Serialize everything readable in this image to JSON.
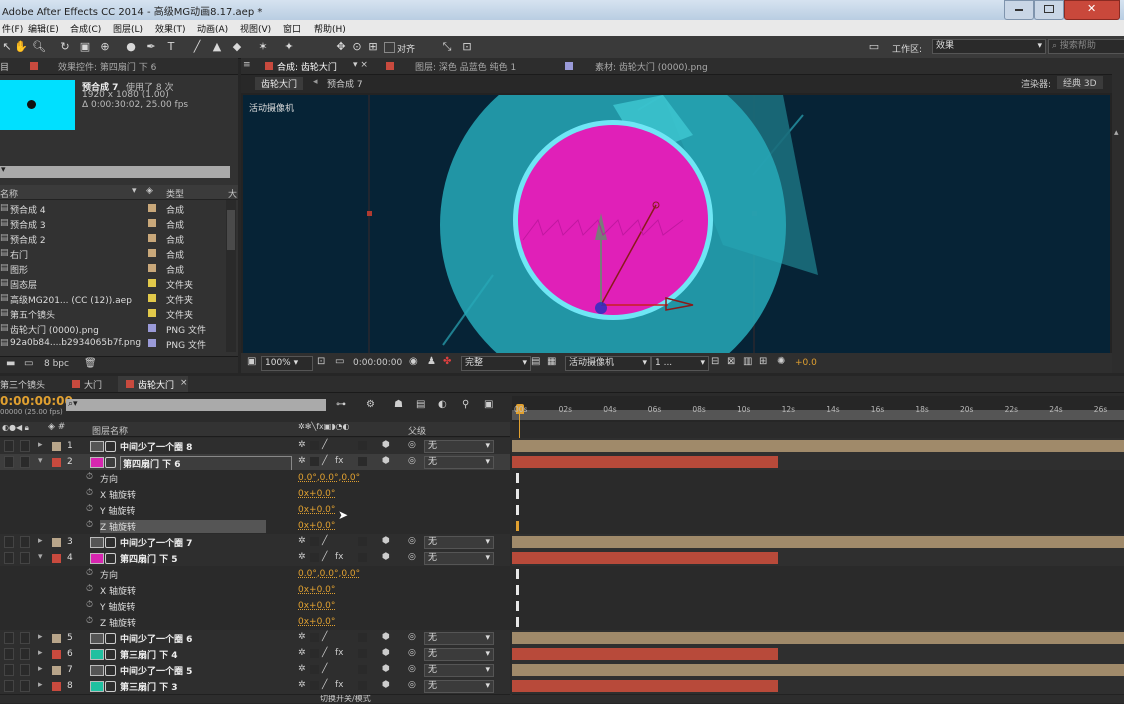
{
  "window": {
    "title": "Adobe After Effects CC 2014 - 高级MG动画8.17.aep *"
  },
  "menu": [
    "件(F)",
    "编辑(E)",
    "合成(C)",
    "图层(L)",
    "效果(T)",
    "动画(A)",
    "视图(V)",
    "窗口",
    "帮助(H)"
  ],
  "toolbar": {
    "align_label": "对齐",
    "workspace_label": "工作区:",
    "workspace_value": "效果",
    "search_placeholder": "搜索帮助"
  },
  "project": {
    "tab_label": "目",
    "effects_tab": "效果控件: 第四扇门 下 6",
    "item_name": "预合成 7",
    "usage": "使用了 8 次",
    "dims": "1920 x 1080 (1.00)",
    "duration": "Δ 0:00:30:02, 25.00 fps",
    "col_name": "名称",
    "col_type": "类型",
    "col_size": "大",
    "bpc": "8 bpc",
    "items": [
      {
        "name": "预合成 4",
        "type": "合成",
        "color": "#c9a87a"
      },
      {
        "name": "预合成 3",
        "type": "合成",
        "color": "#c9a87a"
      },
      {
        "name": "预合成 2",
        "type": "合成",
        "color": "#c9a87a"
      },
      {
        "name": "右门",
        "type": "合成",
        "color": "#c9a87a"
      },
      {
        "name": "图形",
        "type": "合成",
        "color": "#c9a87a"
      },
      {
        "name": "固态层",
        "type": "文件夹",
        "color": "#e2c94a"
      },
      {
        "name": "高级MG201... (CC (12)).aep",
        "type": "文件夹",
        "color": "#e2c94a"
      },
      {
        "name": "第五个镜头",
        "type": "文件夹",
        "color": "#e2c94a"
      },
      {
        "name": "齿轮大门 (0000).png",
        "type": "PNG 文件",
        "color": "#9a9ad8"
      },
      {
        "name": "92a0b84....b2934065b7f.png",
        "type": "PNG 文件",
        "color": "#9a9ad8"
      }
    ]
  },
  "viewer": {
    "tab_comp": "合成: 齿轮大门",
    "tab_layer": "图层: 深色 品蓝色 纯色 1",
    "tab_footage": "素材: 齿轮大门 (0000).png",
    "breadcrumb1": "齿轮大门",
    "breadcrumb2": "预合成 7",
    "renderer_label": "渲染器:",
    "renderer_value": "经典 3D",
    "camera_label": "活动摄像机",
    "zoom": "100%",
    "timecode": "0:00:00:00",
    "quality": "完整",
    "view_camera": "活动摄像机",
    "views": "1 ...",
    "exposure": "+0.0"
  },
  "timeline": {
    "tabs": [
      "第三个镜头",
      "大门",
      "齿轮大门"
    ],
    "timecode": "0:00:00:00",
    "fps": "00000 (25.00 fps)",
    "col_layername": "图层名称",
    "col_parent": "父级",
    "ruler": [
      "00s",
      "02s",
      "04s",
      "06s",
      "08s",
      "10s",
      "12s",
      "14s",
      "16s",
      "18s",
      "20s",
      "22s",
      "24s",
      "26s"
    ],
    "layers": [
      {
        "num": "1",
        "name": "中间少了一个圈 8",
        "color": "#b8a58a",
        "parent": "无",
        "bar": "tan"
      },
      {
        "num": "2",
        "name": "第四扇门 下 6",
        "color": "#c84a3e",
        "parent": "无",
        "bar": "red",
        "selected": true
      },
      {
        "num": "3",
        "name": "中间少了一个圈 7",
        "color": "#b8a58a",
        "parent": "无",
        "bar": "tan"
      },
      {
        "num": "4",
        "name": "第四扇门 下 5",
        "color": "#c84a3e",
        "parent": "无",
        "bar": "red"
      },
      {
        "num": "5",
        "name": "中间少了一个圈 6",
        "color": "#b8a58a",
        "parent": "无",
        "bar": "tan"
      },
      {
        "num": "6",
        "name": "第三扇门 下 4",
        "color": "#c84a3e",
        "parent": "无",
        "bar": "red"
      },
      {
        "num": "7",
        "name": "中间少了一个圈 5",
        "color": "#b8a58a",
        "parent": "无",
        "bar": "tan"
      },
      {
        "num": "8",
        "name": "第三扇门 下 3",
        "color": "#c84a3e",
        "parent": "无",
        "bar": "red"
      }
    ],
    "props": [
      {
        "label": "方向",
        "value": "0.0°,0.0°,0.0°"
      },
      {
        "label": "X 轴旋转",
        "value": "0x+0.0°"
      },
      {
        "label": "Y 轴旋转",
        "value": "0x+0.0°"
      },
      {
        "label": "Z 轴旋转",
        "value": "0x+0.0°"
      }
    ],
    "footer": "切换开关/模式"
  }
}
